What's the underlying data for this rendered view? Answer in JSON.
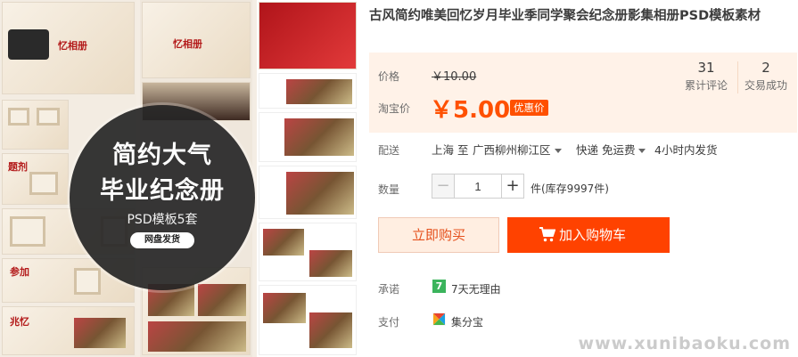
{
  "product": {
    "title": "古风简约唯美回忆岁月毕业季同学聚会纪念册影集相册PSD模板素材"
  },
  "gallery": {
    "badge_line1": "简约大气",
    "badge_line2": "毕业纪念册",
    "badge_sub": "PSD模板5套",
    "badge_pill": "网盘发货"
  },
  "price": {
    "label": "价格",
    "original": "￥10.00",
    "taobao_label": "淘宝价",
    "current": "￥5.00",
    "promo": "优惠价"
  },
  "stats": [
    {
      "num": "31",
      "label": "累计评论"
    },
    {
      "num": "2",
      "label": "交易成功"
    }
  ],
  "shipping": {
    "label": "配送",
    "from": "上海 至",
    "to": "广西柳州柳江区",
    "method": "快递 免运费",
    "dispatch": "4小时内发货"
  },
  "quantity": {
    "label": "数量",
    "value": "1",
    "minus": "−",
    "plus": "+",
    "stock": "件(库存9997件)"
  },
  "buttons": {
    "buy_now": "立即购买",
    "add_cart": "加入购物车"
  },
  "promise": {
    "label": "承诺",
    "icon_text": "7",
    "value": "7天无理由"
  },
  "payment": {
    "label": "支付",
    "value": "集分宝"
  },
  "watermark": "www.xunibaoku.com",
  "colors": {
    "accent": "#ff5000",
    "cart_button": "#ff4200",
    "price_panel_bg": "#fff2e8",
    "promise_green": "#3bb45c"
  },
  "icons": [
    "caret-down-icon",
    "cart-icon",
    "seven-day-return-icon",
    "jifenbao-icon"
  ]
}
